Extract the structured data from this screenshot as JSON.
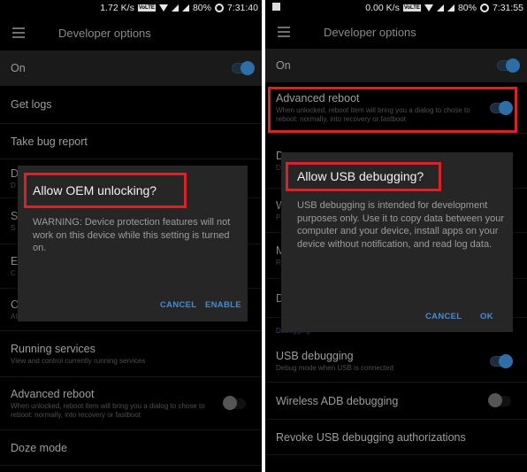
{
  "left": {
    "status": {
      "speed": "1.72 K/s",
      "volte": "VoLTE",
      "battery": "80%",
      "time": "7:31:40"
    },
    "toolbar": {
      "title": "Developer options",
      "menu_icon": "hamburger-icon"
    },
    "master": {
      "label": "On",
      "state": "on"
    },
    "items": [
      {
        "title": "Get logs"
      },
      {
        "title": "Take bug report"
      },
      {
        "title": "D",
        "subtitle": "D"
      },
      {
        "title": "S",
        "subtitle": "S"
      },
      {
        "title": "E",
        "subtitle": "C"
      },
      {
        "title": "OEM unlocking",
        "subtitle": "Allow the bootloader to be unlocked",
        "toggle": "off"
      },
      {
        "title": "Running services",
        "subtitle": "View and control currently running services"
      },
      {
        "title": "Advanced reboot",
        "subtitle": "When unlocked, reboot item will bring you a dialog to chose to reboot: normally, into recovery or fastboot",
        "toggle": "off"
      },
      {
        "title": "Doze mode"
      }
    ],
    "dialog": {
      "title": "Allow OEM unlocking?",
      "body": "WARNING: Device protection features will not work on this device while this setting is turned on.",
      "cancel": "CANCEL",
      "confirm": "ENABLE"
    }
  },
  "right": {
    "status": {
      "speed": "0.00 K/s",
      "volte": "VoLTE",
      "battery": "80%",
      "time": "7:31:55"
    },
    "toolbar": {
      "title": "Developer options",
      "menu_icon": "hamburger-icon"
    },
    "master": {
      "label": "On",
      "state": "on"
    },
    "items": [
      {
        "title": "Advanced reboot",
        "subtitle": "When unlocked, reboot item will bring you a dialog to chose to reboot: normally, into recovery or fastboot",
        "toggle": "on"
      },
      {
        "title": "D",
        "subtitle": "D"
      },
      {
        "title": "W",
        "subtitle": "P"
      },
      {
        "title": "M",
        "subtitle": "R"
      },
      {
        "title": "D"
      }
    ],
    "section": "Debugging",
    "debug_items": [
      {
        "title": "USB debugging",
        "subtitle": "Debug mode when USB is connected",
        "toggle": "on"
      },
      {
        "title": "Wireless ADB debugging",
        "toggle": "off"
      },
      {
        "title": "Revoke USB debugging authorizations"
      }
    ],
    "dialog": {
      "title": "Allow USB debugging?",
      "body": "USB debugging is intended for development purposes only. Use it to copy data between your computer and your device, install apps on your device without notification, and read log data.",
      "cancel": "CANCEL",
      "confirm": "OK"
    }
  },
  "colors": {
    "accent": "#2e6ea6",
    "button": "#4a8cc8",
    "highlight": "#d7242b",
    "dialog_bg": "#262626"
  }
}
